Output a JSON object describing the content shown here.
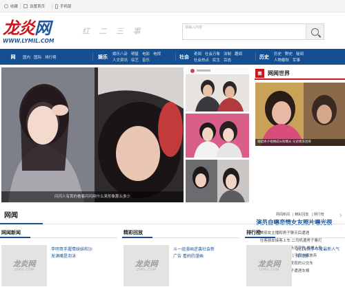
{
  "topbar": {
    "items": [
      {
        "icon": "star-icon",
        "label": "收藏"
      },
      {
        "icon": "home-icon",
        "label": "设置首页"
      },
      {
        "icon": "mobile-icon",
        "label": "手机版"
      }
    ]
  },
  "logo": {
    "main_a": "龙炎",
    "main_b": "网",
    "url": "WWW.LYMIL.COM"
  },
  "slogan": "红 二 三 事",
  "search": {
    "placeholder": "请输入内容"
  },
  "nav": [
    {
      "main": "网",
      "rows": [
        [
          "国内",
          "国际",
          "排行榜"
        ],
        []
      ]
    },
    {
      "main": "娱乐",
      "rows": [
        [
          "娱乐八卦",
          "明星",
          "电影",
          "电视"
        ],
        [
          "人文资讯",
          "综艺",
          "音乐"
        ]
      ]
    },
    {
      "main": "社会",
      "rows": [
        [
          "奇闻",
          "社会万象",
          "法制",
          "趣闻"
        ],
        [
          "社会热点",
          "民生",
          "百态"
        ]
      ]
    },
    {
      "main": "历史",
      "rows": [
        [
          "历史",
          "野史",
          "秘闻"
        ],
        [
          "人物春秋",
          "军事"
        ]
      ]
    }
  ],
  "hero": {
    "caption": "闪闪人有首的看着闪闪用什么来形象那么多少"
  },
  "world": {
    "badge": "图",
    "title": "网闻世界",
    "image_caption": "胡超男子相拥成长照曝光 兄弟情深泪目",
    "headline": "演员自曝恋情女友照片曝光很",
    "items": [
      "美丽女主播和男子聊天后遭遇",
      "住客朋友接客上车 二司机遭男子暴打",
      "印度一男孩掉进下水道获救 救援人员",
      "二团员是妈妈为了儿子而选择放弃",
      "二司机开车上路被发现的公交车",
      "九龄老年夫妻带孙子遭遇车祸"
    ]
  },
  "section": {
    "title": "网闻",
    "links": [
      "网闻新闻",
      "精彩回放",
      "排行榜"
    ],
    "arrow": "›"
  },
  "columns": [
    {
      "title": "网闻新闻",
      "ph1": "龙炎网",
      "ph2": "LYMIL.COM",
      "text": "李明哥手握情妹妹和沙发满嘴是泡沫"
    },
    {
      "title": "精彩回放",
      "ph1": "龙炎网",
      "ph2": "LYMIL.COM",
      "text": "斗一组漫画逆袭社会新广告 看妈的漫画"
    },
    {
      "title": "排行榜",
      "ph1": "龙炎网",
      "ph2": "LYMIL.COM",
      "text": "2018快手年度最新人气排行榜"
    }
  ],
  "colors": {
    "brand_blue": "#154f92",
    "brand_red": "#c8161d"
  }
}
